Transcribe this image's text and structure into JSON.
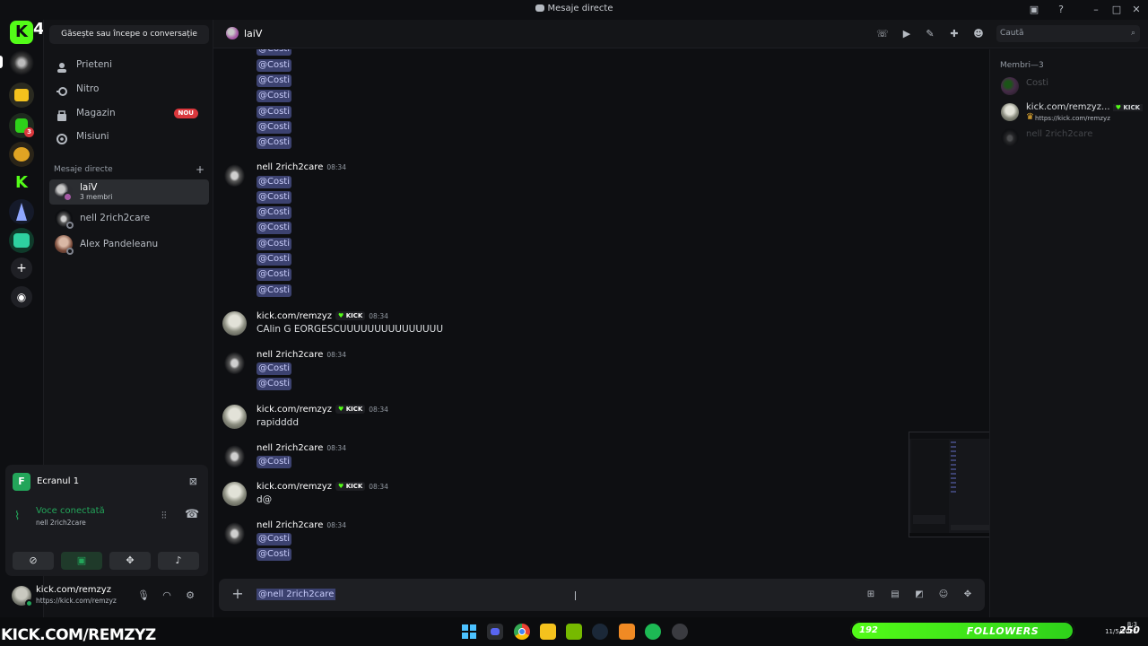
{
  "window": {
    "title": "Mesaje directe"
  },
  "rail": {
    "top_badge": "4",
    "badge_3": "3"
  },
  "sidebar": {
    "search_label": "Găsește sau începe o conversație",
    "nav": [
      {
        "label": "Prieteni"
      },
      {
        "label": "Nitro"
      },
      {
        "label": "Magazin",
        "badge": "NOU"
      },
      {
        "label": "Misiuni"
      }
    ],
    "dm_section": "Mesaje directe",
    "dms": [
      {
        "name": "laiV",
        "sub": "3 membri"
      },
      {
        "name": "nell 2rich2care"
      },
      {
        "name": "Alex Pandeleanu"
      }
    ]
  },
  "voice_panel": {
    "screen_name": "Ecranul 1",
    "status": "Voce conectată",
    "channel": "nell 2rich2care"
  },
  "user": {
    "name": "kick.com/remzyz",
    "status": "https://kick.com/remzyz"
  },
  "header": {
    "channel_name": "laiV",
    "search_placeholder": "Caută"
  },
  "chat": {
    "mention": "@Costi",
    "kick_badge": "KICK",
    "messages": [
      {
        "author": "nell 2rich2care",
        "time": "08:34",
        "mentions": [
          "@Costi",
          "@Costi",
          "@Costi",
          "@Costi",
          "@Costi",
          "@Costi",
          "@Costi",
          "@Costi"
        ]
      },
      {
        "author": "kick.com/remzyz",
        "time": "08:34",
        "text": "CAlin G EORGESCUUUUUUUUUUUUUUU"
      },
      {
        "author": "nell 2rich2care",
        "time": "08:34",
        "mentions": [
          "@Costi",
          "@Costi"
        ]
      },
      {
        "author": "kick.com/remzyz",
        "time": "08:34",
        "text": "rapidddd"
      },
      {
        "author": "nell 2rich2care",
        "time": "08:34",
        "mentions": [
          "@Costi"
        ]
      },
      {
        "author": "kick.com/remzyz",
        "time": "08:34",
        "text": "d@"
      },
      {
        "author": "nell 2rich2care",
        "time": "08:34",
        "mentions": [
          "@Costi",
          "@Costi"
        ]
      }
    ]
  },
  "composer": {
    "value": "@nell 2rich2care"
  },
  "members": {
    "title": "Membri—3",
    "list": [
      {
        "name": "Costi"
      },
      {
        "name": "kick.com/remzyz...",
        "badge": "KICK",
        "sub": "https://kick.com/remzyz"
      },
      {
        "name": "nell 2rich2care"
      }
    ]
  },
  "overlay": {
    "brand": "KICK.COM/REMZYZ",
    "followers_count": "192",
    "followers_label": "FOLLOWERS",
    "followers_goal": "250",
    "clock_time": "8:3",
    "clock_date": "11/5/2025"
  },
  "colors": {
    "accent_green": "#23a55a",
    "kick_green": "#53fc18",
    "mention_bg": "#3c4270",
    "danger": "#da373c"
  }
}
